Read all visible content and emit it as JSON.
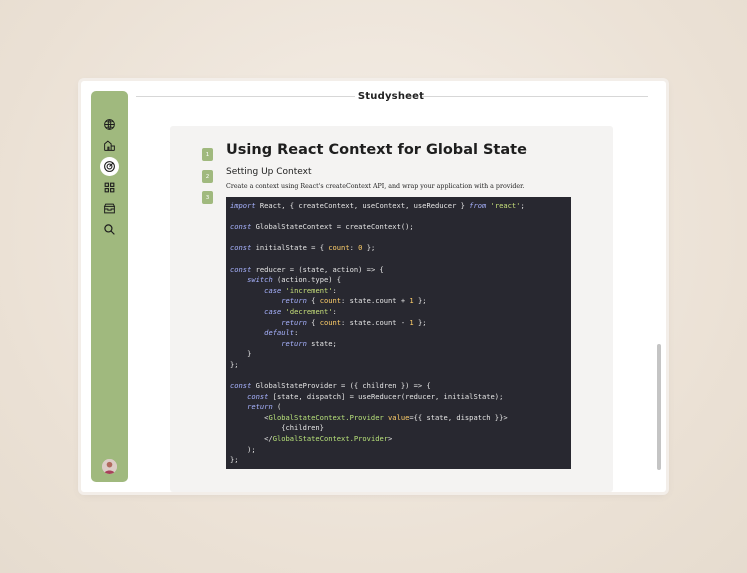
{
  "app": {
    "title": "Studysheet"
  },
  "sidebar": {
    "icons": [
      {
        "name": "atom-icon"
      },
      {
        "name": "book-icon"
      },
      {
        "name": "target-icon",
        "active": true
      },
      {
        "name": "grid-icon"
      },
      {
        "name": "archive-icon"
      },
      {
        "name": "search-icon"
      }
    ]
  },
  "steps": [
    "1",
    "2",
    "3"
  ],
  "article": {
    "title": "Using React Context for Global State",
    "section_title": "Setting Up Context",
    "paragraph": "Create a context using React's createContext API, and wrap your application with a provider."
  },
  "code": {
    "lines": [
      "import React, { createContext, useContext, useReducer } from 'react';",
      "",
      "const GlobalStateContext = createContext();",
      "",
      "const initialState = { count: 0 };",
      "",
      "const reducer = (state, action) => {",
      "    switch (action.type) {",
      "        case 'increment':",
      "            return { count: state.count + 1 };",
      "        case 'decrement':",
      "            return { count: state.count - 1 };",
      "        default:",
      "            return state;",
      "    }",
      "};",
      "",
      "const GlobalStateProvider = ({ children }) => {",
      "    const [state, dispatch] = useReducer(reducer, initialState);",
      "    return (",
      "        <GlobalStateContext.Provider value={{ state, dispatch }}>",
      "            {children}",
      "        </GlobalStateContext.Provider>",
      "    );",
      "};"
    ]
  },
  "colors": {
    "sidebar": "#a0b97e",
    "code_bg": "#282830",
    "keyword": "#a8b3ff",
    "string": "#c7e07a",
    "number": "#ffcf6a"
  }
}
